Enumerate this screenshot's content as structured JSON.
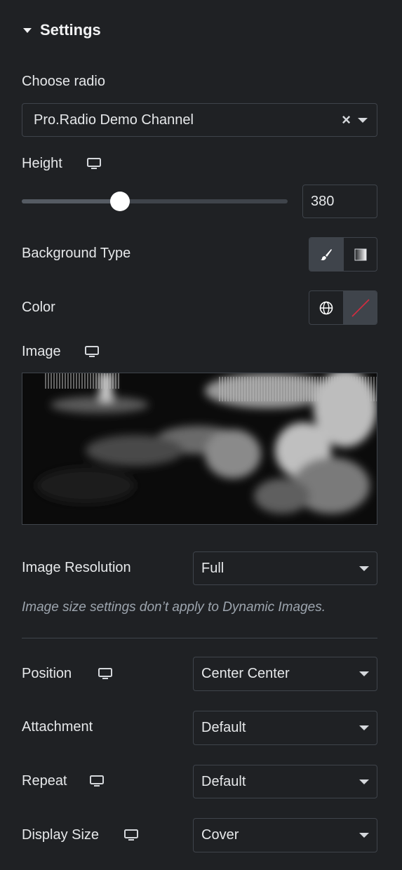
{
  "section": {
    "title": "Settings"
  },
  "radio": {
    "label": "Choose radio",
    "value": "Pro.Radio Demo Channel",
    "clear_glyph": "×"
  },
  "height": {
    "label": "Height",
    "value": "380",
    "slider_fraction": 0.37
  },
  "background_type": {
    "label": "Background Type",
    "options": [
      "classic-brush-icon",
      "gradient-icon"
    ],
    "active": "classic-brush-icon"
  },
  "color": {
    "label": "Color"
  },
  "image": {
    "label": "Image"
  },
  "image_resolution": {
    "label": "Image Resolution",
    "value": "Full",
    "note": "Image size settings don’t apply to Dynamic Images."
  },
  "position": {
    "label": "Position",
    "value": "Center Center"
  },
  "attachment": {
    "label": "Attachment",
    "value": "Default"
  },
  "repeat": {
    "label": "Repeat",
    "value": "Default"
  },
  "display_size": {
    "label": "Display Size",
    "value": "Cover"
  },
  "colors": {
    "background": "#1f2124",
    "border": "#3f444b",
    "text": "#e6e8ea",
    "note": "#9da5ae",
    "no_color_slash": "#d72b3f"
  }
}
